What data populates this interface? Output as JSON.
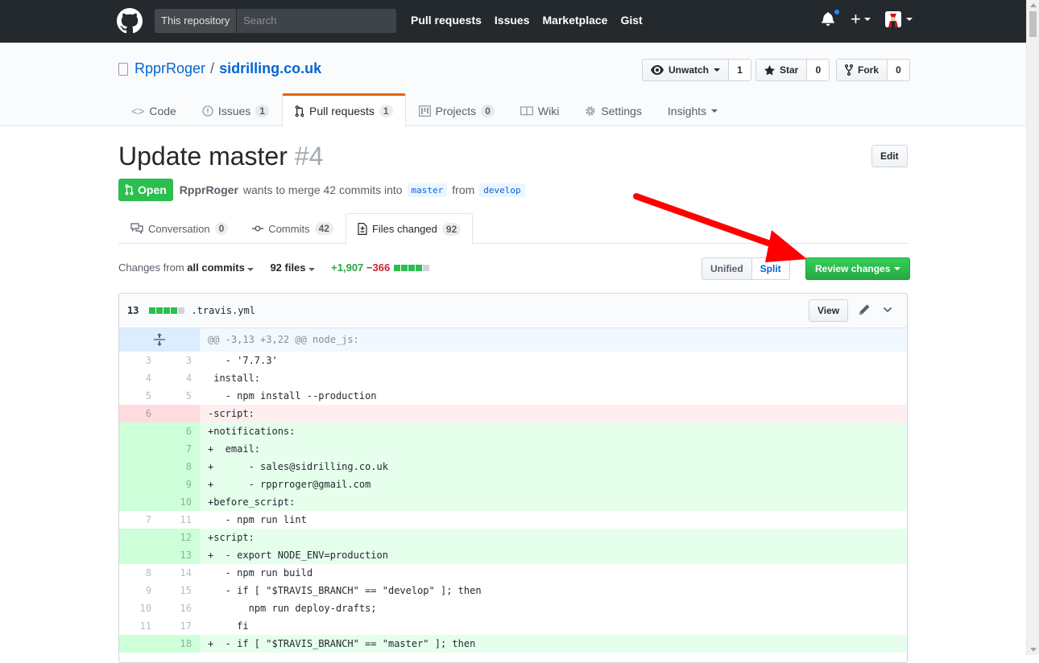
{
  "header": {
    "search_scope": "This repository",
    "search_placeholder": "Search",
    "nav": [
      "Pull requests",
      "Issues",
      "Marketplace",
      "Gist"
    ],
    "plus_label": "+"
  },
  "repo": {
    "owner": "RpprRoger",
    "separator": "/",
    "name": "sidrilling.co.uk",
    "unwatch_label": "Unwatch",
    "watch_count": "1",
    "star_label": "Star",
    "star_count": "0",
    "fork_label": "Fork",
    "fork_count": "0",
    "tabs": [
      {
        "label": "Code",
        "count": ""
      },
      {
        "label": "Issues",
        "count": "1"
      },
      {
        "label": "Pull requests",
        "count": "1"
      },
      {
        "label": "Projects",
        "count": "0"
      },
      {
        "label": "Wiki",
        "count": ""
      },
      {
        "label": "Settings",
        "count": ""
      },
      {
        "label": "Insights",
        "count": ""
      }
    ]
  },
  "pr": {
    "title": "Update master",
    "number": "#4",
    "edit_label": "Edit",
    "state": "Open",
    "author": "RpprRoger",
    "merge_text": "wants to merge 42 commits into",
    "base_branch": "master",
    "from_text": "from",
    "head_branch": "develop",
    "tabs": [
      {
        "label": "Conversation",
        "count": "0"
      },
      {
        "label": "Commits",
        "count": "42"
      },
      {
        "label": "Files changed",
        "count": "92"
      }
    ]
  },
  "toolbar": {
    "changes_from": "Changes from",
    "all_commits": "all commits",
    "files": "92 files",
    "additions": "+1,907",
    "deletions": "−366",
    "unified": "Unified",
    "split": "Split",
    "review": "Review changes"
  },
  "file": {
    "change_count": "13",
    "filename": ".travis.yml",
    "view_label": "View",
    "hunk": "@@ -3,13 +3,22 @@ node_js:",
    "lines": [
      {
        "type": "ctx",
        "old": "3",
        "new": "3",
        "text": "   - '7.7.3'"
      },
      {
        "type": "ctx",
        "old": "4",
        "new": "4",
        "text": " install:"
      },
      {
        "type": "ctx",
        "old": "5",
        "new": "5",
        "text": "   - npm install --production"
      },
      {
        "type": "del",
        "old": "6",
        "new": "",
        "text": "-script:"
      },
      {
        "type": "add",
        "old": "",
        "new": "6",
        "text": "+notifications:"
      },
      {
        "type": "add",
        "old": "",
        "new": "7",
        "text": "+  email:"
      },
      {
        "type": "add",
        "old": "",
        "new": "8",
        "text": "+      - sales@sidrilling.co.uk"
      },
      {
        "type": "add",
        "old": "",
        "new": "9",
        "text": "+      - rpprroger@gmail.com"
      },
      {
        "type": "add",
        "old": "",
        "new": "10",
        "text": "+before_script:"
      },
      {
        "type": "ctx",
        "old": "7",
        "new": "11",
        "text": "   - npm run lint"
      },
      {
        "type": "add",
        "old": "",
        "new": "12",
        "text": "+script:"
      },
      {
        "type": "add",
        "old": "",
        "new": "13",
        "text": "+  - export NODE_ENV=production"
      },
      {
        "type": "ctx",
        "old": "8",
        "new": "14",
        "text": "   - npm run build"
      },
      {
        "type": "ctx",
        "old": "9",
        "new": "15",
        "text": "   - if [ \"$TRAVIS_BRANCH\" == \"develop\" ]; then"
      },
      {
        "type": "ctx",
        "old": "10",
        "new": "16",
        "text": "       npm run deploy-drafts;"
      },
      {
        "type": "ctx",
        "old": "11",
        "new": "17",
        "text": "     fi"
      },
      {
        "type": "add",
        "old": "",
        "new": "18",
        "text": "+  - if [ \"$TRAVIS_BRANCH\" == \"master\" ]; then"
      }
    ]
  },
  "colors": {
    "header_bg": "#24292e",
    "link": "#0366d6",
    "open_green": "#2cbe4e",
    "add_bg": "#e6ffed",
    "del_bg": "#ffeef0",
    "annotation_arrow": "#ff0000"
  }
}
